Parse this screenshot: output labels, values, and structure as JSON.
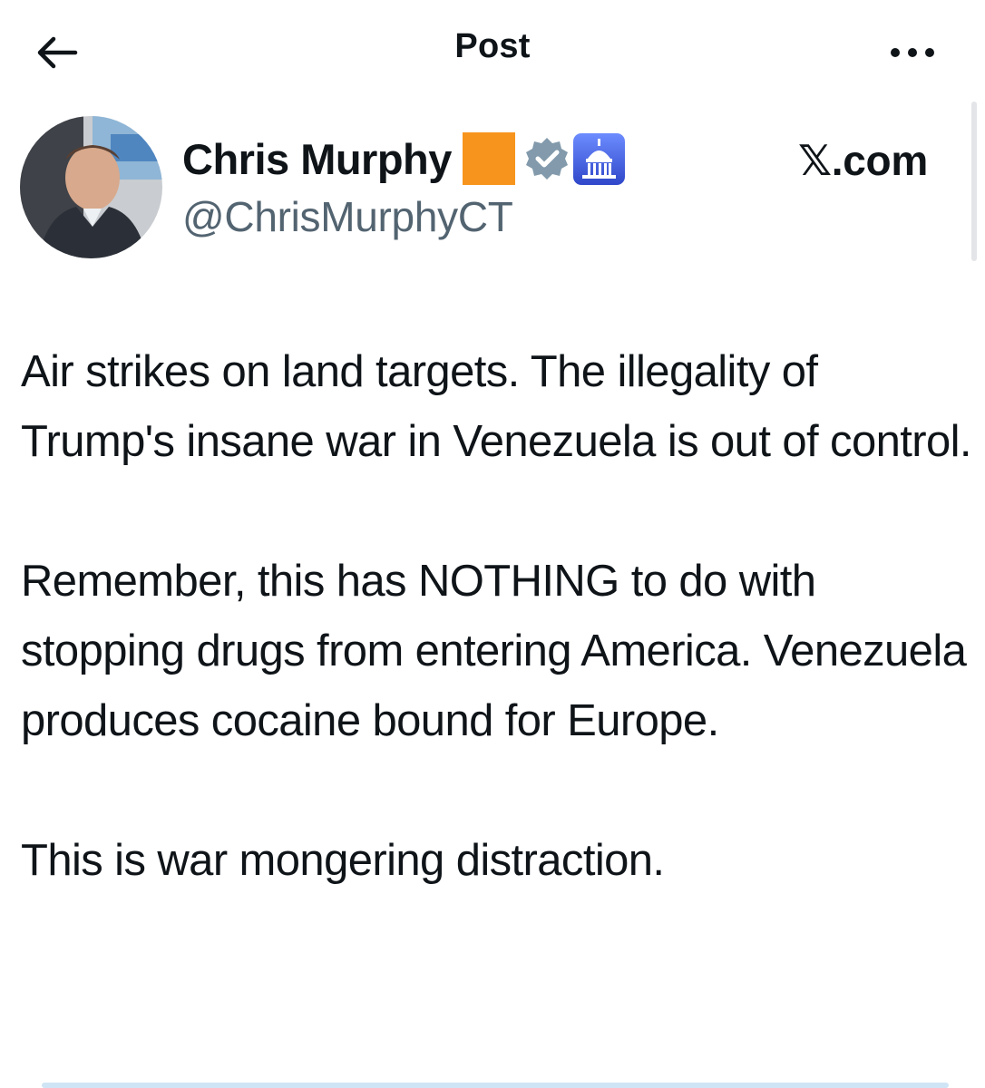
{
  "header": {
    "title": "Post",
    "back_icon": "arrow-left-icon",
    "more_icon": "more-horizontal-icon"
  },
  "author": {
    "display_name": "Chris Murphy",
    "handle": "@ChrisMurphyCT",
    "emoji_badge_color": "#f7941d",
    "verified_badge_color": "#829aab",
    "affiliation_badge": "capitol-icon",
    "affiliation_badge_color": "#3b5bdb"
  },
  "source_label": "𝕏.com",
  "post": {
    "paragraphs": [
      "Air strikes on land targets. The illegality of Trump's insane war in Venezuela is out of control.",
      "Remember, this has NOTHING to do with stopping drugs from entering America. Venezuela produces cocaine bound for Europe.",
      "This is war mongering distraction."
    ]
  }
}
